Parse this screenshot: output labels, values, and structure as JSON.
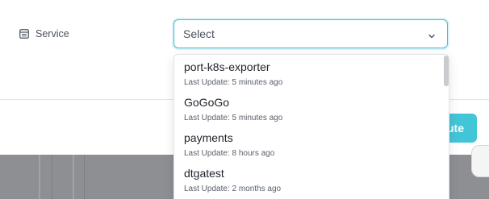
{
  "form": {
    "service_label": "Service",
    "select": {
      "placeholder": "Select"
    }
  },
  "footer": {
    "execute_label": "Execute"
  },
  "dropdown": {
    "options": [
      {
        "name": "port-k8s-exporter",
        "meta": "Last Update: 5 minutes ago"
      },
      {
        "name": "GoGoGo",
        "meta": "Last Update: 5 minutes ago"
      },
      {
        "name": "payments",
        "meta": "Last Update: 8 hours ago"
      },
      {
        "name": "dtgatest",
        "meta": "Last Update: 2 months ago"
      }
    ]
  },
  "colors": {
    "accent": "#43bcd4",
    "button": "#43c5d8"
  },
  "icons": {
    "label_icon": "table-icon",
    "select_icon": "chevron-down-icon"
  }
}
